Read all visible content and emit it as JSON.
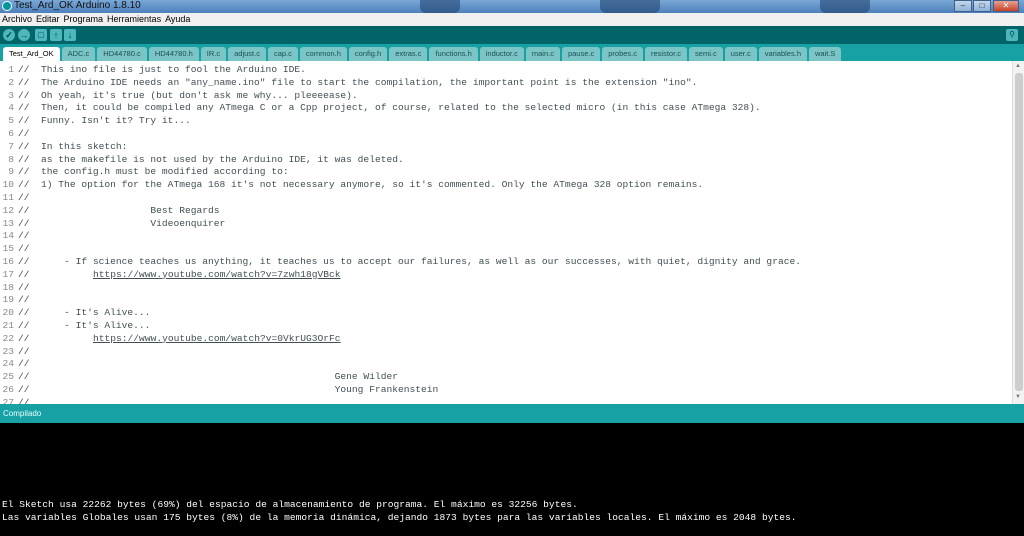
{
  "window": {
    "title": "Test_Ard_OK Arduino 1.8.10"
  },
  "menu": [
    "Archivo",
    "Editar",
    "Programa",
    "Herramientas",
    "Ayuda"
  ],
  "toolbar": {
    "icons": [
      "check-icon",
      "arrow-right-icon",
      "file-new-icon",
      "arrow-up-icon",
      "arrow-down-icon"
    ],
    "serial_icon": "magnifier-icon"
  },
  "tabs": [
    "Test_Ard_OK",
    "ADC.c",
    "HD44780.c",
    "HD44780.h",
    "IR.c",
    "adjust.c",
    "cap.c",
    "common.h",
    "config.h",
    "extras.c",
    "functions.h",
    "inductor.c",
    "main.c",
    "pause.c",
    "probes.c",
    "resistor.c",
    "semi.c",
    "user.c",
    "variables.h",
    "wait.S"
  ],
  "editor": {
    "lines": [
      {
        "n": "1",
        "t": "//  This ino file is just to fool the Arduino IDE."
      },
      {
        "n": "2",
        "t": "//  The Arduino IDE needs an \"any_name.ino\" file to start the compilation, the important point is the extension \"ino\"."
      },
      {
        "n": "3",
        "t": "//  Oh yeah, it's true (but don't ask me why... pleeeease)."
      },
      {
        "n": "4",
        "t": "//  Then, it could be compiled any ATmega C or a Cpp project, of course, related to the selected micro (in this case ATmega 328)."
      },
      {
        "n": "5",
        "t": "//  Funny. Isn't it? Try it..."
      },
      {
        "n": "6",
        "t": "//"
      },
      {
        "n": "7",
        "t": "//  In this sketch:"
      },
      {
        "n": "8",
        "t": "//  as the makefile is not used by the Arduino IDE, it was deleted."
      },
      {
        "n": "9",
        "t": "//  the config.h must be modified according to:"
      },
      {
        "n": "10",
        "t": "//  1) The option for the ATmega 168 it's not necessary anymore, so it's commented. Only the ATmega 328 option remains."
      },
      {
        "n": "11",
        "t": "//"
      },
      {
        "n": "12",
        "t": "//                     Best Regards"
      },
      {
        "n": "13",
        "t": "//                     Videoenquirer"
      },
      {
        "n": "14",
        "t": "//"
      },
      {
        "n": "15",
        "t": "//"
      },
      {
        "n": "16",
        "t": "//      - If science teaches us anything, it teaches us to accept our failures, as well as our successes, with quiet, dignity and grace."
      },
      {
        "n": "17",
        "t": "//"
      },
      {
        "n": "18",
        "t": "//"
      },
      {
        "n": "19",
        "t": "//"
      },
      {
        "n": "20",
        "t": "//      - It's Alive..."
      },
      {
        "n": "21",
        "t": "//      - It's Alive..."
      },
      {
        "n": "22",
        "t": "//"
      },
      {
        "n": "23",
        "t": "//"
      },
      {
        "n": "24",
        "t": "//"
      },
      {
        "n": "25",
        "t": "//                                                     Gene Wilder"
      },
      {
        "n": "26",
        "t": "//                                                     Young Frankenstein"
      },
      {
        "n": "27",
        "t": "//"
      }
    ],
    "link1": "https://www.youtube.com/watch?v=7zwh18gVBck",
    "link2": "https://www.youtube.com/watch?v=0VkrUG3OrFc"
  },
  "status": {
    "message": "Compilado"
  },
  "console": {
    "line1": "El Sketch usa 22262 bytes (69%) del espacio de almacenamiento de programa. El máximo es 32256 bytes.",
    "line2": "Las variables Globales usan 175 bytes (8%) de la memoria dinámica, dejando 1873 bytes para las variables locales. El máximo es 2048 bytes."
  },
  "colors": {
    "toolbar": "#006468",
    "tabbar": "#17a1a5",
    "console": "#000000"
  }
}
